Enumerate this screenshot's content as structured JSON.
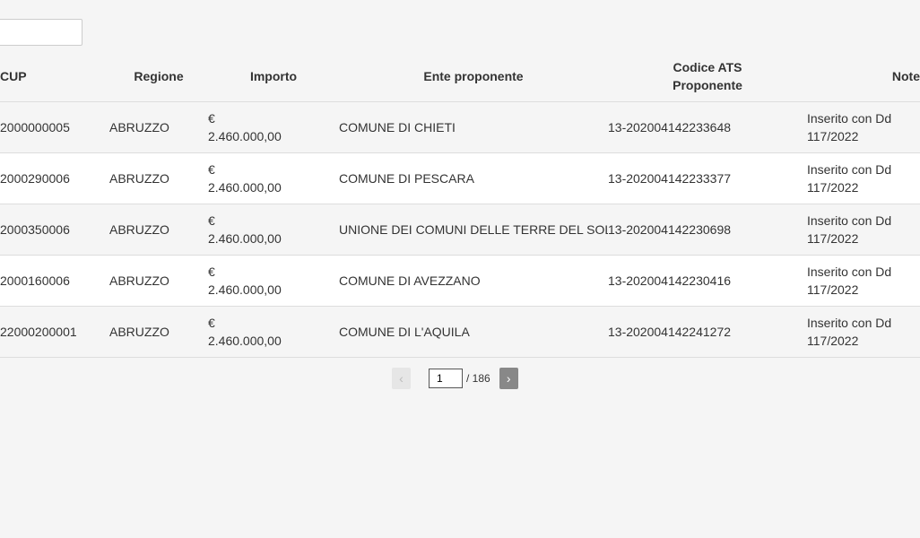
{
  "filter": {
    "value": ""
  },
  "columns": {
    "cup": "CUP",
    "regione": "Regione",
    "importo": "Importo",
    "ente": "Ente proponente",
    "codice_line1": "Codice ATS",
    "codice_line2": "Proponente",
    "note": "Note"
  },
  "rows": [
    {
      "cup": "2000000005",
      "regione": "ABRUZZO",
      "importo_cur": "€",
      "importo_val": "2.460.000,00",
      "ente": "COMUNE DI CHIETI",
      "codice": "13-202004142233648",
      "note_1": "Inserito con Dd",
      "note_2": "117/2022"
    },
    {
      "cup": "2000290006",
      "regione": "ABRUZZO",
      "importo_cur": "€",
      "importo_val": "2.460.000,00",
      "ente": "COMUNE DI PESCARA",
      "codice": "13-202004142233377",
      "note_1": "Inserito con Dd",
      "note_2": "117/2022"
    },
    {
      "cup": "2000350006",
      "regione": "ABRUZZO",
      "importo_cur": "€",
      "importo_val": "2.460.000,00",
      "ente": "UNIONE DEI COMUNI DELLE TERRE DEL SOLE",
      "codice": "13-202004142230698",
      "note_1": "Inserito con Dd",
      "note_2": "117/2022"
    },
    {
      "cup": "2000160006",
      "regione": "ABRUZZO",
      "importo_cur": "€",
      "importo_val": "2.460.000,00",
      "ente": "COMUNE DI AVEZZANO",
      "codice": "13-202004142230416",
      "note_1": "Inserito con Dd",
      "note_2": "117/2022"
    },
    {
      "cup": "22000200001",
      "regione": "ABRUZZO",
      "importo_cur": "€",
      "importo_val": "2.460.000,00",
      "ente": "COMUNE DI L'AQUILA",
      "codice": "13-202004142241272",
      "note_1": "Inserito con Dd",
      "note_2": "117/2022"
    }
  ],
  "pagination": {
    "prev_label": "‹",
    "next_label": "›",
    "current_page": "1",
    "total_label": "/ 186"
  }
}
